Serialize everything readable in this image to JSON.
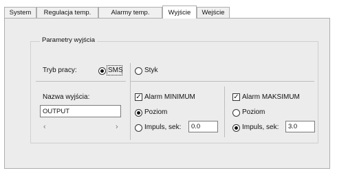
{
  "tabs": [
    {
      "label": "System",
      "active": false
    },
    {
      "label": "Regulacja temp.",
      "active": false
    },
    {
      "label": "Alarmy temp.",
      "active": false
    },
    {
      "label": "Wyjście",
      "active": true
    },
    {
      "label": "Wejście",
      "active": false
    }
  ],
  "group": {
    "title": "Parametry wyjścia",
    "mode_label": "Tryb pracy:",
    "mode_sms": "SMS",
    "mode_styk": "Styk",
    "mode_selected": "SMS",
    "name_label": "Nazwa wyjścia:",
    "name_value": "OUTPUT",
    "scroll_left": "‹",
    "scroll_right": "›"
  },
  "alarm_min": {
    "label": "Alarm MINIMUM",
    "checked": true,
    "opt_level": "Poziom",
    "opt_pulse": "Impuls, sek:",
    "selected": "Poziom",
    "pulse_value": "0.0"
  },
  "alarm_max": {
    "label": "Alarm MAKSIMUM",
    "checked": true,
    "opt_level": "Poziom",
    "opt_pulse": "Impuls, sek:",
    "selected": "Impuls",
    "pulse_value": "3.0"
  },
  "icons": {
    "check": "✓"
  }
}
